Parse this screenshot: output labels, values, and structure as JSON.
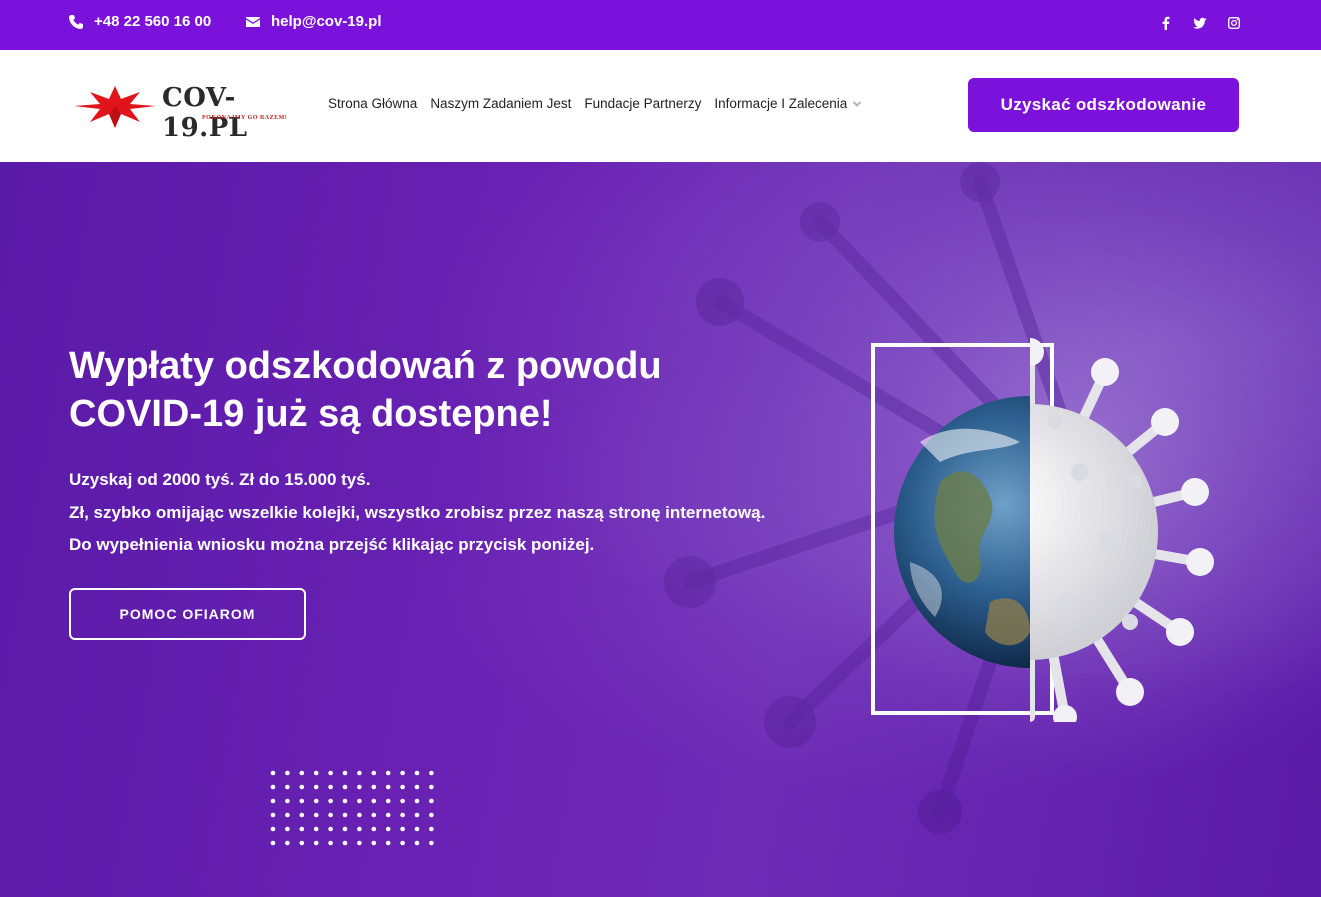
{
  "topbar": {
    "phone": "+48 22 560 16 00",
    "email": "help@cov-19.pl",
    "socials": [
      "facebook-icon",
      "twitter-icon",
      "instagram-icon"
    ]
  },
  "header": {
    "logo_text": "COV-19.PL",
    "logo_tagline": "POKONAJMY GO RAZEM!",
    "nav": [
      {
        "label": "Strona Główna"
      },
      {
        "label": "Naszym Zadaniem Jest"
      },
      {
        "label": "Fundacje Partnerzy"
      },
      {
        "label": "Informacje I Zalecenia",
        "has_dropdown": true
      }
    ],
    "cta_label": "Uzyskać odszkodowanie"
  },
  "hero": {
    "title_line1": "Wypłaty odszkodowań z powodu",
    "title_line2": "COVID-19 już są dostepne!",
    "text_line1": "Uzyskaj od 2000 tyś. Zł do 15.000 tyś.",
    "text_line2": "Zł, szybko omijając wszelkie kolejki, wszystko zrobisz przez naszą stronę internetową.",
    "text_line3": "Do wypełnienia wniosku można przejść klikając przycisk poniżej.",
    "button_label": "POMOC OFIAROM"
  },
  "colors": {
    "brand": "#7b12db",
    "hero_bg": "#5e1dab",
    "white": "#ffffff"
  }
}
